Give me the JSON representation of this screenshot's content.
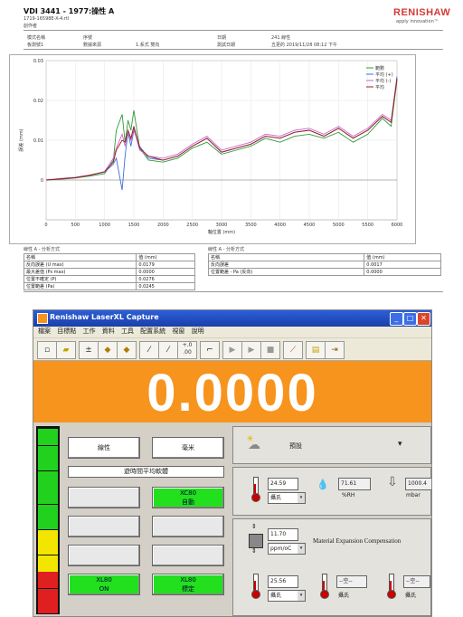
{
  "report": {
    "title": "VDI 3441 - 1977:操性 A",
    "file": "1719-16598E-X-4.rtl",
    "author": "創作者",
    "logo_text": "RENISHAW",
    "logo_sub": "apply innovation™",
    "meta_row1": [
      "模式名稱",
      "序號",
      "日期",
      "241 線性"
    ],
    "meta_row2": [
      "板測號1",
      "數據來源",
      "1.系式 雙向",
      "測試日期",
      "五更的 2019/11/28 08:12 下午"
    ],
    "legend": [
      "範數",
      "平均 (+)",
      "平均 (-)",
      "平均"
    ],
    "xlabel": "軸位置 (mm)",
    "ylabel": "誤差 (mm)",
    "table_left": {
      "title": "線性 A - 分析方式",
      "header": [
        "名稱",
        "值 (mm)"
      ],
      "rows": [
        [
          "反向誤差 (U max)",
          "0.0179"
        ],
        [
          "最大差值 (Ps max)",
          "0.0000"
        ],
        [
          "位置不確定 (P)",
          "0.0276"
        ],
        [
          "位置範差 (Pa)",
          "0.0245"
        ]
      ]
    },
    "table_right": {
      "title": "線性 A - 分析方式",
      "header": [
        "名稱",
        "值 (mm)"
      ],
      "rows": [
        [
          "反向誤差",
          "0.0017"
        ],
        [
          "位置範差 - Pa (反向)",
          "0.0000"
        ]
      ]
    }
  },
  "chart_data": {
    "type": "line",
    "title": "",
    "xlabel": "軸位置 (mm)",
    "ylabel": "誤差 (mm)",
    "xlim": [
      0,
      6000
    ],
    "ylim": [
      -0.01,
      0.03
    ],
    "x_ticks": [
      0,
      500,
      1000,
      1500,
      2000,
      2500,
      3000,
      3500,
      4000,
      4500,
      5000,
      5500,
      6000
    ],
    "y_ticks": [
      0,
      0.01,
      0.02,
      0.03
    ],
    "grid": true,
    "legend_position": "top-right",
    "x": [
      0,
      250,
      500,
      750,
      1000,
      1150,
      1200,
      1300,
      1350,
      1400,
      1450,
      1500,
      1600,
      1750,
      2000,
      2250,
      2500,
      2750,
      3000,
      3250,
      3500,
      3750,
      4000,
      4250,
      4500,
      4750,
      5000,
      5250,
      5500,
      5750,
      5900,
      6000
    ],
    "series": [
      {
        "name": "範數",
        "color": "#2e9b3a",
        "values": [
          0.0,
          0.0002,
          0.0005,
          0.001,
          0.0016,
          0.005,
          0.0125,
          0.0165,
          0.0095,
          0.015,
          0.0125,
          0.0175,
          0.008,
          0.005,
          0.0045,
          0.0055,
          0.008,
          0.0095,
          0.0065,
          0.0075,
          0.0085,
          0.0105,
          0.0095,
          0.011,
          0.0115,
          0.0105,
          0.012,
          0.0095,
          0.0115,
          0.0155,
          0.0135,
          0.025
        ]
      },
      {
        "name": "平均 (+)",
        "color": "#3f6fd8",
        "values": [
          0.0,
          0.0003,
          0.0006,
          0.0012,
          0.002,
          0.004,
          0.0055,
          -0.0025,
          0.006,
          0.012,
          0.0085,
          0.0125,
          0.0085,
          0.0055,
          0.005,
          0.006,
          0.0085,
          0.0105,
          0.007,
          0.008,
          0.009,
          0.011,
          0.0105,
          0.012,
          0.0125,
          0.011,
          0.013,
          0.0105,
          0.0125,
          0.016,
          0.0145,
          0.026
        ]
      },
      {
        "name": "平均 (-)",
        "color": "#cc66cc",
        "values": [
          0.0,
          0.0004,
          0.0007,
          0.0013,
          0.0021,
          0.0055,
          0.008,
          0.0115,
          0.0085,
          0.012,
          0.01,
          0.013,
          0.0075,
          0.006,
          0.0055,
          0.0065,
          0.009,
          0.011,
          0.0075,
          0.0085,
          0.0095,
          0.0115,
          0.011,
          0.0125,
          0.013,
          0.0115,
          0.0135,
          0.011,
          0.013,
          0.0165,
          0.015,
          0.0255
        ]
      },
      {
        "name": "平均",
        "color": "#a01818",
        "values": [
          0.0,
          0.0003,
          0.0006,
          0.0012,
          0.0021,
          0.0045,
          0.0075,
          0.01,
          0.0095,
          0.0125,
          0.0105,
          0.0135,
          0.008,
          0.006,
          0.005,
          0.006,
          0.0085,
          0.0105,
          0.007,
          0.008,
          0.009,
          0.011,
          0.0105,
          0.012,
          0.0125,
          0.011,
          0.013,
          0.0105,
          0.0125,
          0.016,
          0.0145,
          0.0255
        ]
      }
    ]
  },
  "app": {
    "title": "Renishaw LaserXL Capture",
    "menu": [
      "檔案",
      "目標點",
      "工作",
      "資料",
      "工具",
      "配置系統",
      "視窗",
      "說明"
    ],
    "readout": "0.0000",
    "buttons": {
      "linear": "線性",
      "mm": "毫米",
      "mode": "遊時間平均軟體",
      "xc80_auto_1": "XC80",
      "xc80_auto_2": "自動",
      "xl80_on_1": "XL80",
      "xl80_on_2": "ON",
      "xl80_set_1": "XL80",
      "xl80_set_2": "標定"
    },
    "weather": {
      "label": "預設",
      "dropdown": "▾"
    },
    "air": {
      "temp": "24.59",
      "temp_unit": "攝氏",
      "humidity": "71.61",
      "humidity_unit": "%RH",
      "pressure": "1000.4",
      "pressure_unit": "mbar"
    },
    "material": {
      "coef": "11.70",
      "coef_unit": "ppm/oC",
      "label": "Material Expansion Compensation",
      "t1": "25.56",
      "t1_unit": "攝氏",
      "t2": "--空--",
      "t2_unit": "攝氏",
      "t3": "--空--",
      "t3_unit": "攝氏"
    },
    "level_bar": [
      "green",
      "green",
      "green",
      "green",
      "green",
      "green",
      "green",
      "green",
      "green",
      "green",
      "green",
      "green",
      "yellow",
      "yellow",
      "yellow",
      "yellow",
      "yellow",
      "red",
      "red",
      "red",
      "red",
      "red"
    ]
  }
}
